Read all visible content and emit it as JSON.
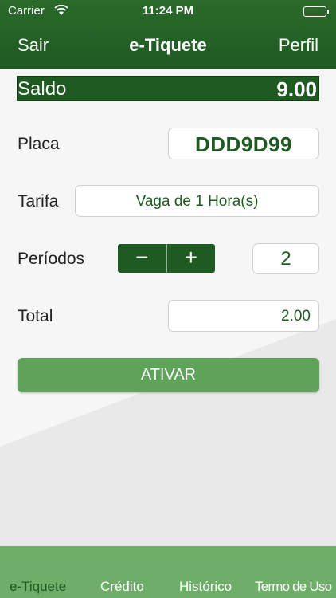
{
  "status_bar": {
    "carrier": "Carrier",
    "time": "11:24 PM",
    "battery_level": 1.0
  },
  "nav": {
    "left": "Sair",
    "title": "e-Tiquete",
    "right": "Perfil"
  },
  "saldo": {
    "label": "Saldo",
    "value": "9.00"
  },
  "form": {
    "placa_label": "Placa",
    "placa_value": "DDD9D99",
    "tarifa_label": "Tarifa",
    "tarifa_value": "Vaga de 1 Hora(s)",
    "periodos_label": "Períodos",
    "decrement": "−",
    "increment": "+",
    "periodos_value": "2",
    "total_label": "Total",
    "total_value": "2.00",
    "submit_label": "ATIVAR"
  },
  "tabs": [
    {
      "label": "e-Tiquete",
      "active": true
    },
    {
      "label": "Crédito",
      "active": false
    },
    {
      "label": "Histórico",
      "active": false
    },
    {
      "label": "Termo de Uso",
      "active": false
    }
  ],
  "colors": {
    "primary": "#1f5a22",
    "accent": "#5fa35a",
    "tabbar": "#6fae69"
  }
}
